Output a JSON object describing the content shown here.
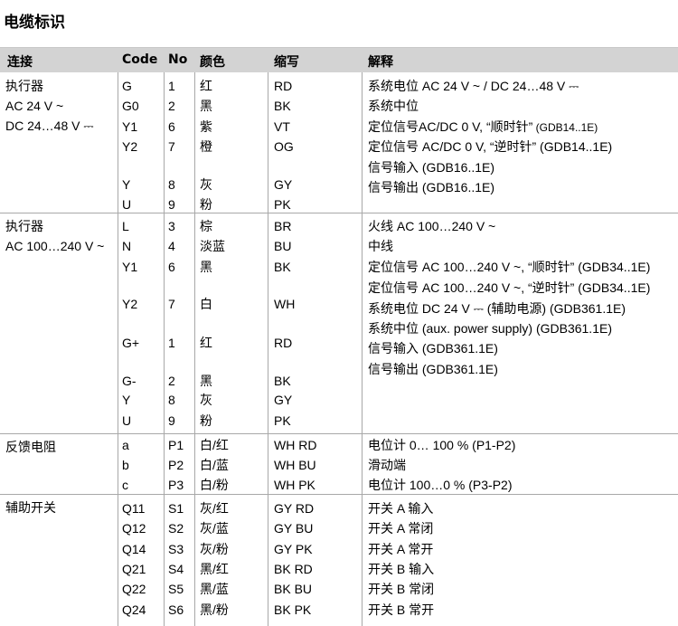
{
  "title": "电缆标识",
  "headers": [
    "连接",
    "Code",
    "No",
    "颜色",
    "缩写",
    "解释"
  ],
  "groups": [
    {
      "connection": [
        "执行器",
        "AC 24 V ~",
        "DC 24…48 V ⎓"
      ],
      "rows": [
        {
          "code": "G",
          "no": "1",
          "color": "红",
          "abbr": "RD",
          "desc": "系统电位 AC 24 V ~ / DC 24…48 V ⎓"
        },
        {
          "code": "G0",
          "no": "2",
          "color": "黑",
          "abbr": "BK",
          "desc": "系统中位"
        },
        {
          "code": "Y1",
          "no": "6",
          "color": "紫",
          "abbr": "VT",
          "desc": "定位信号AC/DC 0 V, “顺时针”",
          "desc_small": " (GDB14..1E)"
        },
        {
          "code": "Y2",
          "no": "7",
          "color": "橙",
          "abbr": "OG",
          "desc": "定位信号 AC/DC 0 V, “逆时针” (GDB14..1E)"
        },
        {
          "code": "Y",
          "no": "8",
          "color": "灰",
          "abbr": "GY",
          "desc": "信号输入 (GDB16..1E)"
        },
        {
          "code": "U",
          "no": "9",
          "color": "粉",
          "abbr": "PK",
          "desc": "信号输出 (GDB16..1E)"
        }
      ]
    },
    {
      "connection": [
        "执行器",
        "AC 100…240 V ~"
      ],
      "rows": [
        {
          "code": "L",
          "no": "3",
          "color": "棕",
          "abbr": "BR",
          "desc": "火线 AC 100…240 V ~"
        },
        {
          "code": "N",
          "no": "4",
          "color": "淡蓝",
          "abbr": "BU",
          "desc": "中线"
        },
        {
          "code": "Y1",
          "no": "6",
          "color": "黑",
          "abbr": "BK",
          "desc": "定位信号 AC 100…240 V ~, “顺时针” (GDB34..1E)"
        },
        {
          "code": "Y2",
          "no": "7",
          "color": "白",
          "abbr": "WH",
          "desc": "定位信号 AC 100…240 V ~, “逆时针” (GDB34..1E)"
        },
        {
          "code": "G+",
          "no": "1",
          "color": "红",
          "abbr": "RD",
          "desc": "系统电位 DC 24 V ⎓ (辅助电源) (GDB361.1E)"
        },
        {
          "code": "G-",
          "no": "2",
          "color": "黑",
          "abbr": "BK",
          "desc": "系统中位 (aux. power supply) (GDB361.1E)"
        },
        {
          "code": "Y",
          "no": "8",
          "color": "灰",
          "abbr": "GY",
          "desc": "信号输入 (GDB361.1E)"
        },
        {
          "code": "U",
          "no": "9",
          "color": "粉",
          "abbr": "PK",
          "desc": "信号输出 (GDB361.1E)"
        }
      ]
    },
    {
      "connection": [
        "反馈电阻"
      ],
      "rows": [
        {
          "code": "a",
          "no": "P1",
          "color": "白/红",
          "abbr": "WH RD",
          "desc": "电位计 0… 100 % (P1-P2)"
        },
        {
          "code": "b",
          "no": "P2",
          "color": "白/蓝",
          "abbr": "WH BU",
          "desc": "滑动端"
        },
        {
          "code": "c",
          "no": "P3",
          "color": "白/粉",
          "abbr": "WH PK",
          "desc": "电位计 100…0 % (P3-P2)"
        }
      ]
    },
    {
      "connection": [
        "辅助开关"
      ],
      "rows": [
        {
          "code": "Q11",
          "no": "S1",
          "color": "灰/红",
          "abbr": "GY RD",
          "desc": "开关 A  输入"
        },
        {
          "code": "Q12",
          "no": "S2",
          "color": "灰/蓝",
          "abbr": "GY BU",
          "desc": "开关 A  常闭"
        },
        {
          "code": "Q14",
          "no": "S3",
          "color": "灰/粉",
          "abbr": "GY PK",
          "desc": "开关 A  常开"
        },
        {
          "code": "Q21",
          "no": "S4",
          "color": "黑/红",
          "abbr": "BK RD",
          "desc": "开关 B  输入"
        },
        {
          "code": "Q22",
          "no": "S5",
          "color": "黑/蓝",
          "abbr": "BK BU",
          "desc": "开关 B  常闭"
        },
        {
          "code": "Q24",
          "no": "S6",
          "color": "黑/粉",
          "abbr": "BK PK",
          "desc": "开关 B  常开"
        }
      ]
    }
  ]
}
